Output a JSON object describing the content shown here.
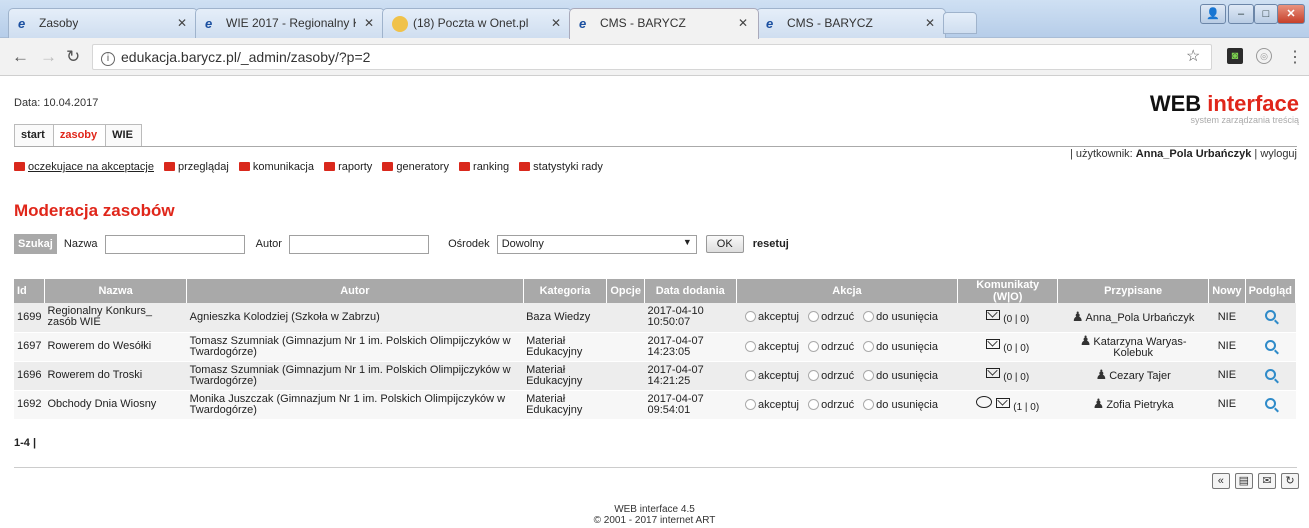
{
  "browser": {
    "tabs": [
      {
        "title": "Zasoby",
        "icon": "c"
      },
      {
        "title": "WIE 2017 - Regionalny K",
        "icon": "c"
      },
      {
        "title": "(18) Poczta w Onet.pl",
        "icon": "mail"
      },
      {
        "title": "CMS - BARYCZ",
        "icon": "c",
        "active": true
      },
      {
        "title": "CMS - BARYCZ",
        "icon": "c"
      }
    ],
    "url": "edukacja.barycz.pl/_admin/zasoby/?p=2"
  },
  "header": {
    "date": "Data: 10.04.2017",
    "logo_main_a": "WEB ",
    "logo_main_b": "interface",
    "logo_sub": "system zarządzania treścią",
    "tabs": [
      "start",
      "zasoby",
      "WIE"
    ],
    "user_prefix": "| użytkownik: ",
    "user_name": "Anna_Pola Urbańczyk",
    "logout": " | wyloguj"
  },
  "subnav": [
    "oczekujace na akceptacje",
    "przeglądaj",
    "komunikacja",
    "raporty",
    "generatory",
    "ranking",
    "statystyki rady"
  ],
  "heading": "Moderacja zasobów",
  "search": {
    "szukaj": "Szukaj",
    "nazwa_label": "Nazwa",
    "autor_label": "Autor",
    "osrodek_label": "Ośrodek",
    "osrodek_value": "Dowolny",
    "ok": "OK",
    "reset": "resetuj"
  },
  "table": {
    "columns": [
      "Id",
      "Nazwa",
      "Autor",
      "Kategoria",
      "Opcje",
      "Data dodania",
      "Akcja",
      "Komunikaty (W|O)",
      "Przypisane",
      "Nowy",
      "Podgląd"
    ],
    "actions": [
      "akceptuj",
      "odrzuć",
      "do usunięcia"
    ],
    "rows": [
      {
        "id": "1699",
        "nazwa": "Regionalny Konkurs_ zasób WIE",
        "autor": "Agnieszka Kolodziej (Szkoła w Zabrzu)",
        "kategoria": "Baza Wiedzy",
        "data": "2017-04-10",
        "czas": "10:50:07",
        "kom": "(0 | 0)",
        "bubble": false,
        "przypisane": "Anna_Pola Urbańczyk",
        "nowy": "NIE"
      },
      {
        "id": "1697",
        "nazwa": "Rowerem do Wesółki",
        "autor": "Tomasz Szumniak (Gimnazjum Nr 1 im. Polskich Olimpijczyków w Twardogórze)",
        "kategoria": "Materiał Edukacyjny",
        "data": "2017-04-07",
        "czas": "14:23:05",
        "kom": "(0 | 0)",
        "bubble": false,
        "przypisane": "Katarzyna Waryas-Kolebuk",
        "nowy": "NIE"
      },
      {
        "id": "1696",
        "nazwa": "Rowerem do Troski",
        "autor": "Tomasz Szumniak (Gimnazjum Nr 1 im. Polskich Olimpijczyków w Twardogórze)",
        "kategoria": "Materiał Edukacyjny",
        "data": "2017-04-07",
        "czas": "14:21:25",
        "kom": "(0 | 0)",
        "bubble": false,
        "przypisane": "Cezary Tajer",
        "nowy": "NIE"
      },
      {
        "id": "1692",
        "nazwa": "Obchody Dnia Wiosny",
        "autor": "Monika Juszczak (Gimnazjum Nr 1 im. Polskich Olimpijczyków w Twardogórze)",
        "kategoria": "Materiał Edukacyjny",
        "data": "2017-04-07",
        "czas": "09:54:01",
        "kom": "(1 | 0)",
        "bubble": true,
        "przypisane": "Zofia Pietryka",
        "nowy": "NIE"
      }
    ]
  },
  "pager": "1-4 |",
  "footer": {
    "line1": "WEB interface 4.5",
    "line2": "© 2001 - 2017 internet ART"
  }
}
